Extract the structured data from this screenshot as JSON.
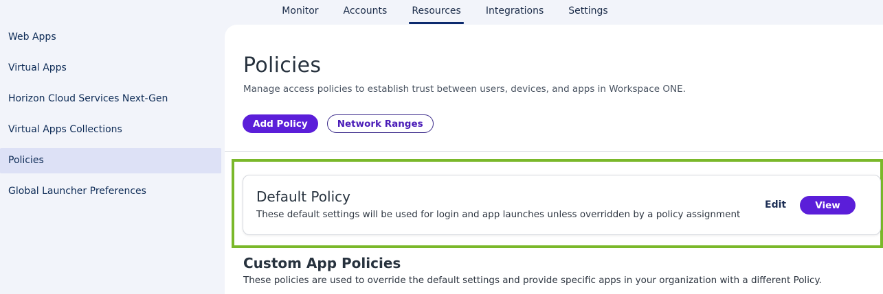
{
  "topnav": {
    "tabs": [
      {
        "label": "Monitor"
      },
      {
        "label": "Accounts"
      },
      {
        "label": "Resources"
      },
      {
        "label": "Integrations"
      },
      {
        "label": "Settings"
      }
    ],
    "active": "Resources"
  },
  "sidebar": {
    "items": [
      {
        "label": "Web Apps"
      },
      {
        "label": "Virtual Apps"
      },
      {
        "label": "Horizon Cloud Services Next-Gen"
      },
      {
        "label": "Virtual Apps Collections"
      },
      {
        "label": "Policies"
      },
      {
        "label": "Global Launcher Preferences"
      }
    ],
    "active": "Policies"
  },
  "main": {
    "title": "Policies",
    "description": "Manage access policies to establish trust between users, devices, and apps in Workspace ONE.",
    "add_policy_label": "Add Policy",
    "network_ranges_label": "Network Ranges",
    "default_policy": {
      "title": "Default Policy",
      "description": "These default settings will be used for login and app launches unless overridden by a policy assignment",
      "edit_label": "Edit",
      "view_label": "View"
    },
    "custom_section": {
      "title": "Custom App Policies",
      "description": "These policies are used to override the default settings and provide specific apps in your organization with a different Policy."
    }
  },
  "colors": {
    "accent": "#5b1ed9",
    "highlight": "#7ab82a",
    "nav_active": "#0c2a6e",
    "sidebar_active": "#dde1f6"
  }
}
